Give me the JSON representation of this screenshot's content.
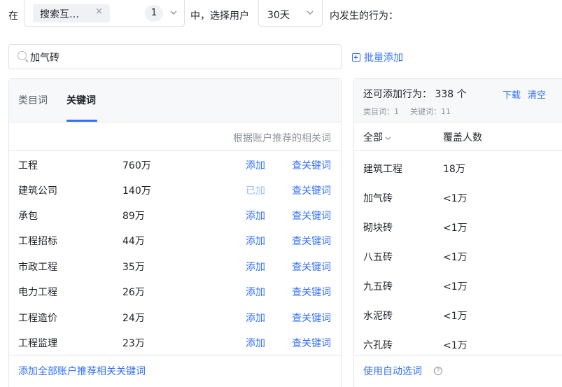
{
  "filter": {
    "prefix": "在",
    "tag_label": "搜索互…",
    "tag_close": "×",
    "count": "1",
    "middle": "中，选择用户",
    "period": "30天",
    "suffix": "内发生的行为："
  },
  "search": {
    "value": "加气砖",
    "placeholder": ""
  },
  "bulk_add_label": "批量添加",
  "left": {
    "tabs": [
      {
        "label": "类目词",
        "active": false
      },
      {
        "label": "关键词",
        "active": true
      }
    ],
    "recommend_title": "根据账户推荐的相关词",
    "rows": [
      {
        "name": "工程",
        "volume": "760万",
        "action": "添加",
        "added": false,
        "check": "查关键词"
      },
      {
        "name": "建筑公司",
        "volume": "140万",
        "action": "已加",
        "added": true,
        "check": "查关键词"
      },
      {
        "name": "承包",
        "volume": "89万",
        "action": "添加",
        "added": false,
        "check": "查关键词"
      },
      {
        "name": "工程招标",
        "volume": "44万",
        "action": "添加",
        "added": false,
        "check": "查关键词"
      },
      {
        "name": "市政工程",
        "volume": "35万",
        "action": "添加",
        "added": false,
        "check": "查关键词"
      },
      {
        "name": "电力工程",
        "volume": "26万",
        "action": "添加",
        "added": false,
        "check": "查关键词"
      },
      {
        "name": "工程造价",
        "volume": "24万",
        "action": "添加",
        "added": false,
        "check": "查关键词"
      },
      {
        "name": "工程监理",
        "volume": "23万",
        "action": "添加",
        "added": false,
        "check": "查关键词"
      }
    ],
    "footer_link": "添加全部账户推荐相关关键词"
  },
  "right": {
    "remaining": "还可添加行为： 338 个",
    "download": "下载",
    "clear": "清空",
    "stats_category": "类目词：1",
    "stats_keyword": "关键词：11",
    "col_all": "全部",
    "col_cover": "覆盖人数",
    "rows": [
      {
        "name": "建筑工程",
        "cover": "18万"
      },
      {
        "name": "加气砖",
        "cover": "<1万"
      },
      {
        "name": "砌块砖",
        "cover": "<1万"
      },
      {
        "name": "八五砖",
        "cover": "<1万"
      },
      {
        "name": "九五砖",
        "cover": "<1万"
      },
      {
        "name": "水泥砖",
        "cover": "<1万"
      },
      {
        "name": "六孔砖",
        "cover": "<1万"
      }
    ],
    "footer_link": "使用自动选词",
    "help_glyph": "?"
  },
  "colors": {
    "accent": "#3370ff",
    "accent_disabled": "#9ec1ff",
    "text": "#1f2329",
    "muted": "#8f959e",
    "border": "#e4e6eb",
    "panel_header_bg": "#f7f8fa"
  }
}
